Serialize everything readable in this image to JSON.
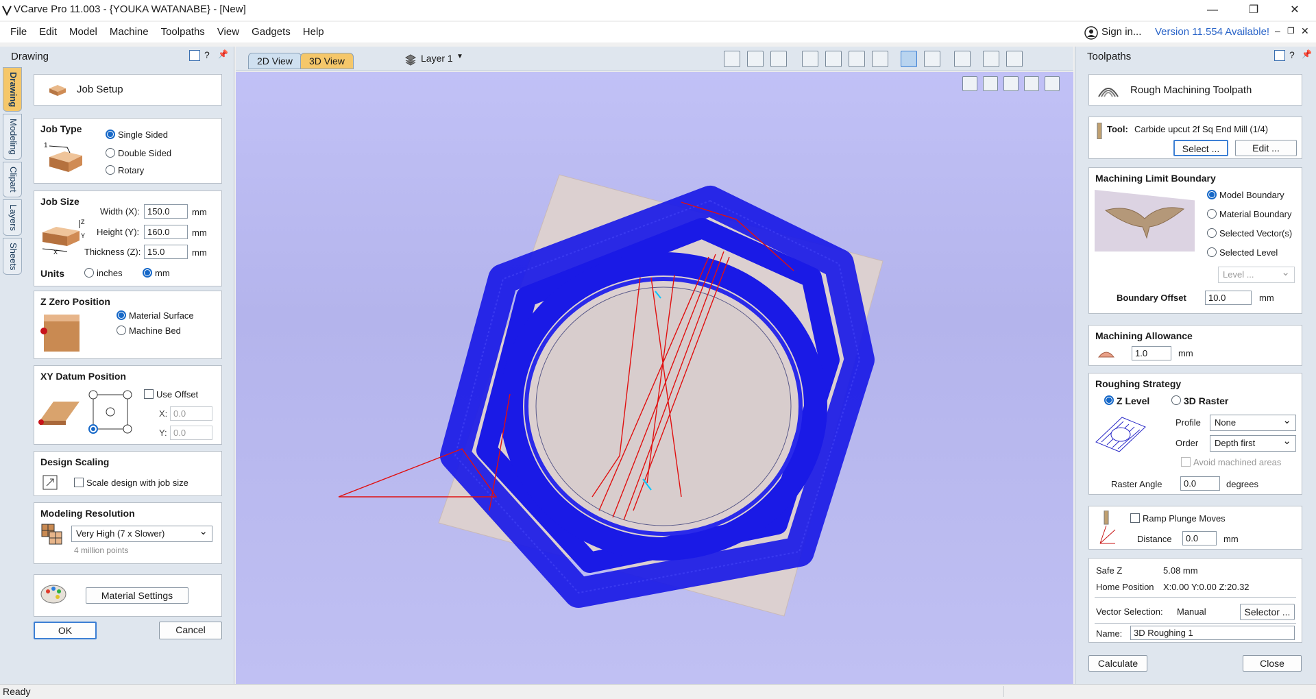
{
  "window": {
    "title": "VCarve Pro 11.003 - {YOUKA WATANABE} - [New]",
    "minimize": "—",
    "maximize": "❐",
    "close": "✕"
  },
  "menu": {
    "items": [
      "File",
      "Edit",
      "Model",
      "Machine",
      "Toolpaths",
      "View",
      "Gadgets",
      "Help"
    ],
    "signin": "Sign in...",
    "version": "Version 11.554 Available!",
    "mdi_min": "–",
    "mdi_restore": "❐",
    "mdi_close": "✕"
  },
  "left": {
    "title": "Drawing",
    "vtabs": [
      "Drawing",
      "Modeling",
      "Clipart",
      "Layers",
      "Sheets"
    ],
    "job_setup": "Job Setup",
    "job_type": {
      "title": "Job Type",
      "options": [
        "Single Sided",
        "Double Sided",
        "Rotary"
      ],
      "selected": 0
    },
    "job_size": {
      "title": "Job Size",
      "width_label": "Width (X):",
      "width": "150.0",
      "height_label": "Height (Y):",
      "height": "160.0",
      "thick_label": "Thickness (Z):",
      "thick": "15.0",
      "unit": "mm"
    },
    "units": {
      "title": "Units",
      "inches": "inches",
      "mm": "mm",
      "selected": "mm"
    },
    "zzero": {
      "title": "Z Zero Position",
      "options": [
        "Material Surface",
        "Machine Bed"
      ],
      "selected": 0
    },
    "xy": {
      "title": "XY Datum Position",
      "use_offset": "Use Offset",
      "x_label": "X:",
      "x": "0.0",
      "y_label": "Y:",
      "y": "0.0"
    },
    "scaling": {
      "title": "Design Scaling",
      "label": "Scale design with job size"
    },
    "resolution": {
      "title": "Modeling Resolution",
      "value": "Very High (7 x Slower)",
      "points": "4 million points"
    },
    "material_btn": "Material Settings",
    "ok": "OK",
    "cancel": "Cancel"
  },
  "view": {
    "tab_2d": "2D View",
    "tab_3d": "3D View",
    "layer": "Layer 1"
  },
  "right": {
    "title": "Toolpaths",
    "header": "Rough Machining Toolpath",
    "tool_label": "Tool:",
    "tool": "Carbide upcut 2f Sq End Mill (1/4)",
    "select_btn": "Select ...",
    "edit_btn": "Edit ...",
    "boundary": {
      "title": "Machining Limit Boundary",
      "options": [
        "Model Boundary",
        "Material Boundary",
        "Selected Vector(s)",
        "Selected Level"
      ],
      "selected": 0,
      "level": "Level ...",
      "offset_label": "Boundary Offset",
      "offset": "10.0",
      "unit": "mm"
    },
    "allowance": {
      "title": "Machining Allowance",
      "value": "1.0",
      "unit": "mm"
    },
    "strategy": {
      "title": "Roughing Strategy",
      "zlevel": "Z Level",
      "raster": "3D Raster",
      "profile_label": "Profile",
      "profile": "None",
      "order_label": "Order",
      "order": "Depth first",
      "avoid": "Avoid machined areas",
      "angle_label": "Raster Angle",
      "angle": "0.0",
      "angle_unit": "degrees"
    },
    "ramp": {
      "label": "Ramp Plunge Moves",
      "dist_label": "Distance",
      "dist": "0.0",
      "unit": "mm"
    },
    "safe_z_label": "Safe Z",
    "safe_z": "5.08 mm",
    "home_label": "Home Position",
    "home": "X:0.00 Y:0.00 Z:20.32",
    "vecsel_label": "Vector Selection:",
    "vecsel": "Manual",
    "selector_btn": "Selector ...",
    "name_label": "Name:",
    "name": "3D Roughing 1",
    "calculate": "Calculate",
    "close": "Close"
  },
  "status": "Ready",
  "colors": {
    "toolpath": "#1a1ae6",
    "plunge": "#e01010",
    "background": "#bcbcf2",
    "accent": "#1668c8"
  }
}
